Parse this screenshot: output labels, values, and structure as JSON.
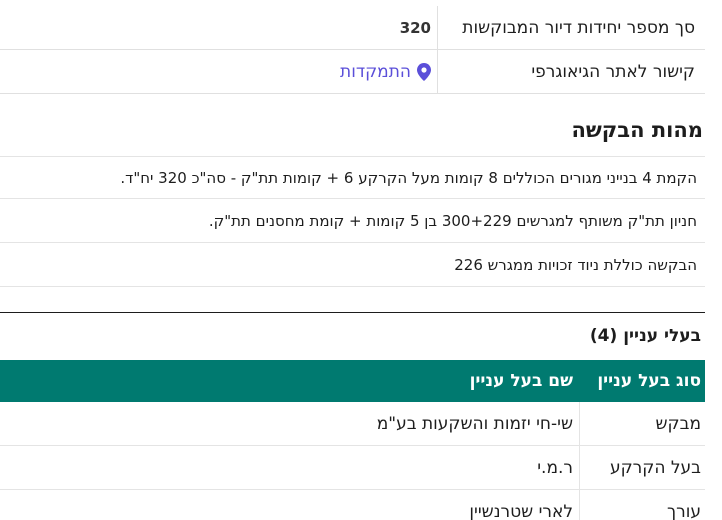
{
  "info": {
    "units_label": "סך מספר יחידות דיור המבוקשות",
    "units_value": "320",
    "geo_label": "קישור לאתר הגיאוגרפי",
    "geo_link_text": "התמקדות",
    "geo_icon": "map-pin-icon",
    "link_color": "#5b4fd9"
  },
  "request": {
    "title": "מהות הבקשה",
    "lines": [
      "הקמת 4 בנייני מגורים הכוללים 8 קומות מעל הקרקע 6 + קומות תת\"ק - סה\"כ 320 יח\"ד.",
      "חניון תת\"ק משותף למגרשים 300+229 בן 5 קומות + קומת מחסנים תת\"ק.",
      "הבקשה כוללת ניוד זכויות ממגרש 226"
    ]
  },
  "stakeholders": {
    "title": "בעלי עניין",
    "count": "(4)",
    "header_color": "#007a70",
    "columns": [
      "סוג בעל עניין",
      "שם בעל עניין"
    ],
    "rows": [
      {
        "type": "מבקש",
        "name": "שי-חי יזמות והשקעות בע\"מ"
      },
      {
        "type": "בעל הקרקע",
        "name": "ר.מ.י"
      },
      {
        "type": "עורך",
        "name": "לארי שטרנשיין"
      }
    ]
  }
}
